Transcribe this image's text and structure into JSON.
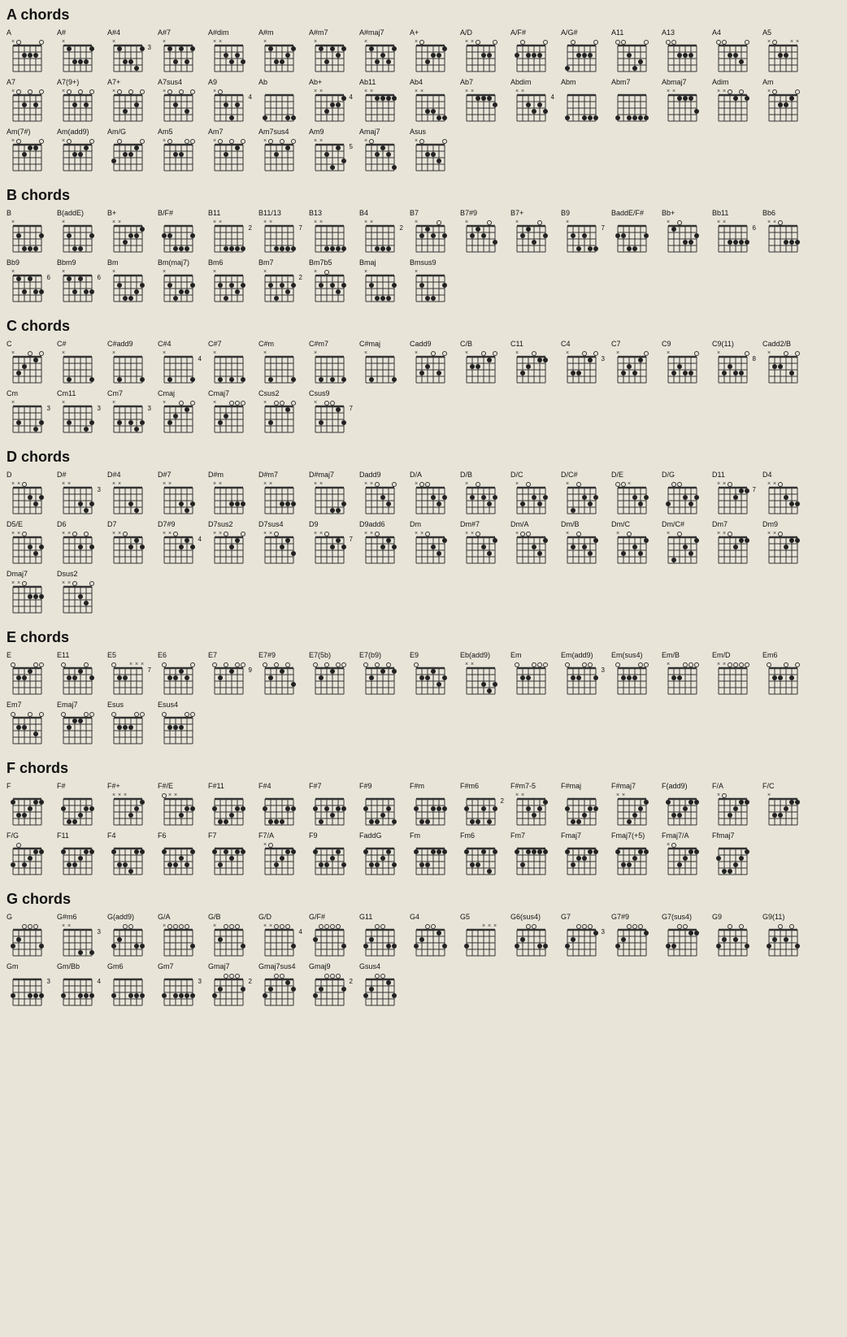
{
  "title": "chords",
  "sections": [
    {
      "id": "A",
      "title": "A chords",
      "chords": [
        {
          "name": "A",
          "strings": "x02220"
        },
        {
          "name": "A#",
          "strings": "x13331"
        },
        {
          "name": "A#4",
          "strings": "x13341",
          "fret": 3
        },
        {
          "name": "A#7",
          "strings": "x13131"
        },
        {
          "name": "A#dim",
          "strings": "xx2323"
        },
        {
          "name": "A#m",
          "strings": "x13321"
        },
        {
          "name": "A#m7",
          "strings": "x13121"
        },
        {
          "name": "A#maj7",
          "strings": "x13231"
        },
        {
          "name": "A+",
          "strings": "x03221"
        },
        {
          "name": "A/D",
          "strings": "xx0220"
        },
        {
          "name": "A/F#",
          "strings": "202220"
        },
        {
          "name": "A/G#",
          "strings": "402220"
        },
        {
          "name": "A11",
          "strings": "002430"
        },
        {
          "name": "A13",
          "strings": "002226"
        },
        {
          "name": "A4",
          "strings": "002230"
        },
        {
          "name": "A5",
          "strings": "x022xx"
        },
        {
          "name": "A7",
          "strings": "x02020"
        },
        {
          "name": "A7(9+)",
          "strings": "x02020"
        },
        {
          "name": "A7+",
          "strings": "x03020"
        },
        {
          "name": "A7sus4",
          "strings": "x02030"
        },
        {
          "name": "A9",
          "strings": "x02426",
          "fret": 4
        },
        {
          "name": "Ab",
          "strings": "466544"
        },
        {
          "name": "Ab+",
          "strings": "xx3221",
          "fret": 4
        },
        {
          "name": "Ab11",
          "strings": "xx1111"
        },
        {
          "name": "Ab4",
          "strings": "xx3344"
        },
        {
          "name": "Ab7",
          "strings": "xx1112"
        },
        {
          "name": "Abdim",
          "strings": "xx2323",
          "fret": 4
        },
        {
          "name": "Abm",
          "strings": "466444"
        },
        {
          "name": "Abm7",
          "strings": "464444"
        },
        {
          "name": "Abmaj7",
          "strings": "xx1113"
        },
        {
          "name": "Adim",
          "strings": "xx0101"
        },
        {
          "name": "Am",
          "strings": "x02210"
        },
        {
          "name": "Am(7#)",
          "strings": "x02110"
        },
        {
          "name": "Am(add9)",
          "strings": "x02210"
        },
        {
          "name": "Am/G",
          "strings": "302210"
        },
        {
          "name": "Am5",
          "strings": "x02200"
        },
        {
          "name": "Am7",
          "strings": "x02010"
        },
        {
          "name": "Am7sus4",
          "strings": "x02010"
        },
        {
          "name": "Am9",
          "strings": "xx2413",
          "fret": 5
        },
        {
          "name": "Amaj7",
          "strings": "x02124"
        },
        {
          "name": "Asus",
          "strings": "x02230"
        }
      ]
    },
    {
      "id": "B",
      "title": "B chords",
      "chords": [
        {
          "name": "B",
          "strings": "x24442"
        },
        {
          "name": "B(addE)",
          "strings": "x24452"
        },
        {
          "name": "B+",
          "strings": "xx3221"
        },
        {
          "name": "B/F#",
          "strings": "224442"
        },
        {
          "name": "B11",
          "strings": "xx4444",
          "fret": 2
        },
        {
          "name": "B11/13",
          "strings": "xx4444",
          "fret": 7
        },
        {
          "name": "B13",
          "strings": "xx4444"
        },
        {
          "name": "B4",
          "strings": "xx4445",
          "fret": 2
        },
        {
          "name": "B7",
          "strings": "x21202"
        },
        {
          "name": "B7#9",
          "strings": "x21203"
        },
        {
          "name": "B7+",
          "strings": "x21302"
        },
        {
          "name": "B9",
          "strings": "x24244",
          "fret": 7
        },
        {
          "name": "BaddE/F#",
          "strings": "224452"
        },
        {
          "name": "Bb+",
          "strings": "x10332"
        },
        {
          "name": "Bb11",
          "strings": "xx3333",
          "fret": 6
        },
        {
          "name": "Bb6",
          "strings": "xx0333"
        },
        {
          "name": "Bb9",
          "strings": "x13133",
          "fret": 6
        },
        {
          "name": "Bbm9",
          "strings": "x13133",
          "fret": 6
        },
        {
          "name": "Bm",
          "strings": "x24432"
        },
        {
          "name": "Bm(maj7)",
          "strings": "x24332"
        },
        {
          "name": "Bm6",
          "strings": "x24232"
        },
        {
          "name": "Bm7",
          "strings": "x24232",
          "fret": 2
        },
        {
          "name": "Bm7b5",
          "strings": "x20232"
        },
        {
          "name": "Bmaj",
          "strings": "x24442"
        },
        {
          "name": "Bmsus9",
          "strings": "x24452"
        }
      ]
    },
    {
      "id": "C",
      "title": "C chords",
      "chords": [
        {
          "name": "C",
          "strings": "x32010"
        },
        {
          "name": "C#",
          "strings": "x46664"
        },
        {
          "name": "C#add9",
          "strings": "x46664"
        },
        {
          "name": "C#4",
          "strings": "x46674",
          "fret": 4
        },
        {
          "name": "C#7",
          "strings": "x46464"
        },
        {
          "name": "C#m",
          "strings": "x46654"
        },
        {
          "name": "C#m7",
          "strings": "x46454"
        },
        {
          "name": "C#maj",
          "strings": "x46664"
        },
        {
          "name": "Cadd9",
          "strings": "x32030"
        },
        {
          "name": "C/B",
          "strings": "x22010"
        },
        {
          "name": "C11",
          "strings": "x32011"
        },
        {
          "name": "C4",
          "strings": "x33010",
          "fret": 3
        },
        {
          "name": "C7",
          "strings": "x32310"
        },
        {
          "name": "C9",
          "strings": "x32330"
        },
        {
          "name": "C9(11)",
          "strings": "x32330",
          "fret": 8
        },
        {
          "name": "Cadd2/B",
          "strings": "x22030"
        },
        {
          "name": "Cm",
          "strings": "x35543",
          "fret": 3
        },
        {
          "name": "Cm11",
          "strings": "x35543",
          "fret": 3
        },
        {
          "name": "Cm7",
          "strings": "x35343",
          "fret": 3
        },
        {
          "name": "Cmaj",
          "strings": "x32010"
        },
        {
          "name": "Cmaj7",
          "strings": "x32000"
        },
        {
          "name": "Csus2",
          "strings": "x30010"
        },
        {
          "name": "Csus9",
          "strings": "x30013",
          "fret": 7
        }
      ]
    },
    {
      "id": "D",
      "title": "D chords",
      "chords": [
        {
          "name": "D",
          "strings": "xx0232"
        },
        {
          "name": "D#",
          "strings": "xx5343",
          "fret": 3
        },
        {
          "name": "D#4",
          "strings": "xx5345"
        },
        {
          "name": "D#7",
          "strings": "xx5343"
        },
        {
          "name": "D#m",
          "strings": "xx5333"
        },
        {
          "name": "D#m7",
          "strings": "xx5333"
        },
        {
          "name": "D#maj7",
          "strings": "xx5443"
        },
        {
          "name": "Dadd9",
          "strings": "xx0230"
        },
        {
          "name": "D/A",
          "strings": "x00232"
        },
        {
          "name": "D/B",
          "strings": "x20232"
        },
        {
          "name": "D/C",
          "strings": "x30232"
        },
        {
          "name": "D/C#",
          "strings": "x40232"
        },
        {
          "name": "D/E",
          "strings": "00x232"
        },
        {
          "name": "D/G",
          "strings": "300232"
        },
        {
          "name": "D11",
          "strings": "xx0211",
          "fret": 7
        },
        {
          "name": "D4",
          "strings": "xx0233"
        },
        {
          "name": "D5/E",
          "strings": "xx0232"
        },
        {
          "name": "D6",
          "strings": "xx0202"
        },
        {
          "name": "D7",
          "strings": "xx0212"
        },
        {
          "name": "D7#9",
          "strings": "xx0212",
          "fret": 4
        },
        {
          "name": "D7sus2",
          "strings": "xx0210"
        },
        {
          "name": "D7sus4",
          "strings": "xx0213"
        },
        {
          "name": "D9",
          "strings": "xx0212",
          "fret": 7
        },
        {
          "name": "D9add6",
          "strings": "xx0212"
        },
        {
          "name": "Dm",
          "strings": "xx0231"
        },
        {
          "name": "Dm#7",
          "strings": "xx0231"
        },
        {
          "name": "Dm/A",
          "strings": "x00231"
        },
        {
          "name": "Dm/B",
          "strings": "x20231"
        },
        {
          "name": "Dm/C",
          "strings": "x30231"
        },
        {
          "name": "Dm/C#",
          "strings": "x40231"
        },
        {
          "name": "Dm7",
          "strings": "xx0211"
        },
        {
          "name": "Dm9",
          "strings": "xx0211"
        },
        {
          "name": "Dmaj7",
          "strings": "xx0222"
        },
        {
          "name": "Dsus2",
          "strings": "xx0230"
        }
      ]
    },
    {
      "id": "E",
      "title": "E chords",
      "chords": [
        {
          "name": "E",
          "strings": "022100"
        },
        {
          "name": "E11",
          "strings": "022102"
        },
        {
          "name": "E5",
          "strings": "022xxx",
          "fret": 7
        },
        {
          "name": "E6",
          "strings": "022120"
        },
        {
          "name": "E7",
          "strings": "020100",
          "fret": 9
        },
        {
          "name": "E7#9",
          "strings": "020103"
        },
        {
          "name": "E7(5b)",
          "strings": "020100"
        },
        {
          "name": "E7(b9)",
          "strings": "020101"
        },
        {
          "name": "E9",
          "strings": "022132"
        },
        {
          "name": "Eb(add9)",
          "strings": "xx5343"
        },
        {
          "name": "Em",
          "strings": "022000"
        },
        {
          "name": "Em(add9)",
          "strings": "022002",
          "fret": 3
        },
        {
          "name": "Em(sus4)",
          "strings": "022200"
        },
        {
          "name": "Em/B",
          "strings": "x22000"
        },
        {
          "name": "Em/D",
          "strings": "xx0000"
        },
        {
          "name": "Em6",
          "strings": "022020"
        },
        {
          "name": "Em7",
          "strings": "022030"
        },
        {
          "name": "Emaj7",
          "strings": "021100"
        },
        {
          "name": "Esus",
          "strings": "022200"
        },
        {
          "name": "Esus4",
          "strings": "022200",
          "fret": 0
        }
      ]
    },
    {
      "id": "F",
      "title": "F chords",
      "chords": [
        {
          "name": "F",
          "strings": "133211"
        },
        {
          "name": "F#",
          "strings": "244322"
        },
        {
          "name": "F#+",
          "strings": "xxx321"
        },
        {
          "name": "F#/E",
          "strings": "0xx322"
        },
        {
          "name": "F#11",
          "strings": "244322"
        },
        {
          "name": "F#4",
          "strings": "244422"
        },
        {
          "name": "F#7",
          "strings": "242322"
        },
        {
          "name": "F#9",
          "strings": "244324"
        },
        {
          "name": "F#m",
          "strings": "244222"
        },
        {
          "name": "F#m6",
          "strings": "244242",
          "fret": 2
        },
        {
          "name": "F#m7-5",
          "strings": "xx2321"
        },
        {
          "name": "F#maj",
          "strings": "244322",
          "fret": 0
        },
        {
          "name": "F#maj7",
          "strings": "xx4321"
        },
        {
          "name": "F(add9)",
          "strings": "133211"
        },
        {
          "name": "F/A",
          "strings": "x03211"
        },
        {
          "name": "F/C",
          "strings": "x33211"
        },
        {
          "name": "F/G",
          "strings": "303211"
        },
        {
          "name": "F11",
          "strings": "133211"
        },
        {
          "name": "F4",
          "strings": "133411"
        },
        {
          "name": "F6",
          "strings": "133231"
        },
        {
          "name": "F7",
          "strings": "131211"
        },
        {
          "name": "F7/A",
          "strings": "x03211"
        },
        {
          "name": "F9",
          "strings": "133213"
        },
        {
          "name": "FaddG",
          "strings": "133213"
        },
        {
          "name": "Fm",
          "strings": "133111"
        },
        {
          "name": "Fm6",
          "strings": "133141"
        },
        {
          "name": "Fm7",
          "strings": "131111"
        },
        {
          "name": "Fmaj7",
          "strings": "132211"
        },
        {
          "name": "Fmaj7(+5)",
          "strings": "133211"
        },
        {
          "name": "Fmaj7/A",
          "strings": "x03211"
        },
        {
          "name": "Ffmaj7",
          "strings": "244321"
        }
      ]
    },
    {
      "id": "G",
      "title": "G chords",
      "chords": [
        {
          "name": "G",
          "strings": "320003"
        },
        {
          "name": "G#m6",
          "strings": "xx5464",
          "fret": 3
        },
        {
          "name": "G(add9)",
          "strings": "320033"
        },
        {
          "name": "G/A",
          "strings": "x00003"
        },
        {
          "name": "G/B",
          "strings": "x20003"
        },
        {
          "name": "G/D",
          "strings": "xx0003",
          "fret": 4
        },
        {
          "name": "G/F#",
          "strings": "200003"
        },
        {
          "name": "G11",
          "strings": "320033"
        },
        {
          "name": "G4",
          "strings": "320013"
        },
        {
          "name": "G5",
          "strings": "355xxx"
        },
        {
          "name": "G6(sus4)",
          "strings": "320033"
        },
        {
          "name": "G7",
          "strings": "320001",
          "fret": 3
        },
        {
          "name": "G7#9",
          "strings": "320001"
        },
        {
          "name": "G7(sus4)",
          "strings": "330011"
        },
        {
          "name": "G9",
          "strings": "320203"
        },
        {
          "name": "G9(11)",
          "strings": "320203"
        },
        {
          "name": "Gm",
          "strings": "355333",
          "fret": 3
        },
        {
          "name": "Gm/Bb",
          "strings": "355333",
          "fret": 4
        },
        {
          "name": "Gm6",
          "strings": "355333"
        },
        {
          "name": "Gm7",
          "strings": "353333",
          "fret": 3
        },
        {
          "name": "Gmaj7",
          "strings": "320002",
          "fret": 2
        },
        {
          "name": "Gmaj7sus4",
          "strings": "320012"
        },
        {
          "name": "Gmaj9",
          "strings": "320002",
          "fret": 2
        },
        {
          "name": "Gsus4",
          "strings": "320013"
        }
      ]
    }
  ]
}
